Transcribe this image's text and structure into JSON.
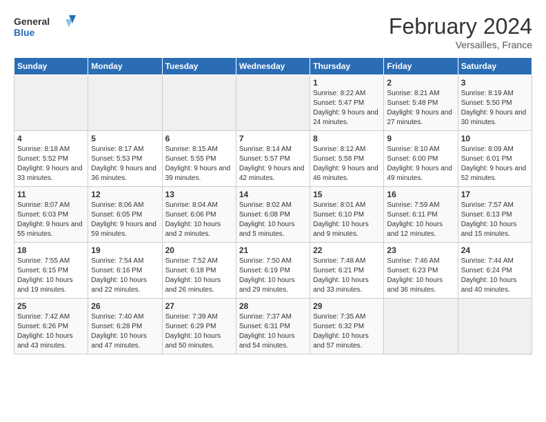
{
  "logo": {
    "text_general": "General",
    "text_blue": "Blue"
  },
  "title": {
    "month_year": "February 2024",
    "location": "Versailles, France"
  },
  "header_days": [
    "Sunday",
    "Monday",
    "Tuesday",
    "Wednesday",
    "Thursday",
    "Friday",
    "Saturday"
  ],
  "weeks": [
    [
      {
        "day": "",
        "empty": true
      },
      {
        "day": "",
        "empty": true
      },
      {
        "day": "",
        "empty": true
      },
      {
        "day": "",
        "empty": true
      },
      {
        "day": "1",
        "sunrise": "8:22 AM",
        "sunset": "5:47 PM",
        "daylight": "9 hours and 24 minutes."
      },
      {
        "day": "2",
        "sunrise": "8:21 AM",
        "sunset": "5:48 PM",
        "daylight": "9 hours and 27 minutes."
      },
      {
        "day": "3",
        "sunrise": "8:19 AM",
        "sunset": "5:50 PM",
        "daylight": "9 hours and 30 minutes."
      }
    ],
    [
      {
        "day": "4",
        "sunrise": "8:18 AM",
        "sunset": "5:52 PM",
        "daylight": "9 hours and 33 minutes."
      },
      {
        "day": "5",
        "sunrise": "8:17 AM",
        "sunset": "5:53 PM",
        "daylight": "9 hours and 36 minutes."
      },
      {
        "day": "6",
        "sunrise": "8:15 AM",
        "sunset": "5:55 PM",
        "daylight": "9 hours and 39 minutes."
      },
      {
        "day": "7",
        "sunrise": "8:14 AM",
        "sunset": "5:57 PM",
        "daylight": "9 hours and 42 minutes."
      },
      {
        "day": "8",
        "sunrise": "8:12 AM",
        "sunset": "5:58 PM",
        "daylight": "9 hours and 46 minutes."
      },
      {
        "day": "9",
        "sunrise": "8:10 AM",
        "sunset": "6:00 PM",
        "daylight": "9 hours and 49 minutes."
      },
      {
        "day": "10",
        "sunrise": "8:09 AM",
        "sunset": "6:01 PM",
        "daylight": "9 hours and 52 minutes."
      }
    ],
    [
      {
        "day": "11",
        "sunrise": "8:07 AM",
        "sunset": "6:03 PM",
        "daylight": "9 hours and 55 minutes."
      },
      {
        "day": "12",
        "sunrise": "8:06 AM",
        "sunset": "6:05 PM",
        "daylight": "9 hours and 59 minutes."
      },
      {
        "day": "13",
        "sunrise": "8:04 AM",
        "sunset": "6:06 PM",
        "daylight": "10 hours and 2 minutes."
      },
      {
        "day": "14",
        "sunrise": "8:02 AM",
        "sunset": "6:08 PM",
        "daylight": "10 hours and 5 minutes."
      },
      {
        "day": "15",
        "sunrise": "8:01 AM",
        "sunset": "6:10 PM",
        "daylight": "10 hours and 9 minutes."
      },
      {
        "day": "16",
        "sunrise": "7:59 AM",
        "sunset": "6:11 PM",
        "daylight": "10 hours and 12 minutes."
      },
      {
        "day": "17",
        "sunrise": "7:57 AM",
        "sunset": "6:13 PM",
        "daylight": "10 hours and 15 minutes."
      }
    ],
    [
      {
        "day": "18",
        "sunrise": "7:55 AM",
        "sunset": "6:15 PM",
        "daylight": "10 hours and 19 minutes."
      },
      {
        "day": "19",
        "sunrise": "7:54 AM",
        "sunset": "6:16 PM",
        "daylight": "10 hours and 22 minutes."
      },
      {
        "day": "20",
        "sunrise": "7:52 AM",
        "sunset": "6:18 PM",
        "daylight": "10 hours and 26 minutes."
      },
      {
        "day": "21",
        "sunrise": "7:50 AM",
        "sunset": "6:19 PM",
        "daylight": "10 hours and 29 minutes."
      },
      {
        "day": "22",
        "sunrise": "7:48 AM",
        "sunset": "6:21 PM",
        "daylight": "10 hours and 33 minutes."
      },
      {
        "day": "23",
        "sunrise": "7:46 AM",
        "sunset": "6:23 PM",
        "daylight": "10 hours and 36 minutes."
      },
      {
        "day": "24",
        "sunrise": "7:44 AM",
        "sunset": "6:24 PM",
        "daylight": "10 hours and 40 minutes."
      }
    ],
    [
      {
        "day": "25",
        "sunrise": "7:42 AM",
        "sunset": "6:26 PM",
        "daylight": "10 hours and 43 minutes."
      },
      {
        "day": "26",
        "sunrise": "7:40 AM",
        "sunset": "6:28 PM",
        "daylight": "10 hours and 47 minutes."
      },
      {
        "day": "27",
        "sunrise": "7:39 AM",
        "sunset": "6:29 PM",
        "daylight": "10 hours and 50 minutes."
      },
      {
        "day": "28",
        "sunrise": "7:37 AM",
        "sunset": "6:31 PM",
        "daylight": "10 hours and 54 minutes."
      },
      {
        "day": "29",
        "sunrise": "7:35 AM",
        "sunset": "6:32 PM",
        "daylight": "10 hours and 57 minutes."
      },
      {
        "day": "",
        "empty": true
      },
      {
        "day": "",
        "empty": true
      }
    ]
  ],
  "labels": {
    "sunrise": "Sunrise:",
    "sunset": "Sunset:",
    "daylight": "Daylight hours"
  },
  "colors": {
    "header_bg": "#2a6db5",
    "logo_blue": "#2a6db5"
  }
}
